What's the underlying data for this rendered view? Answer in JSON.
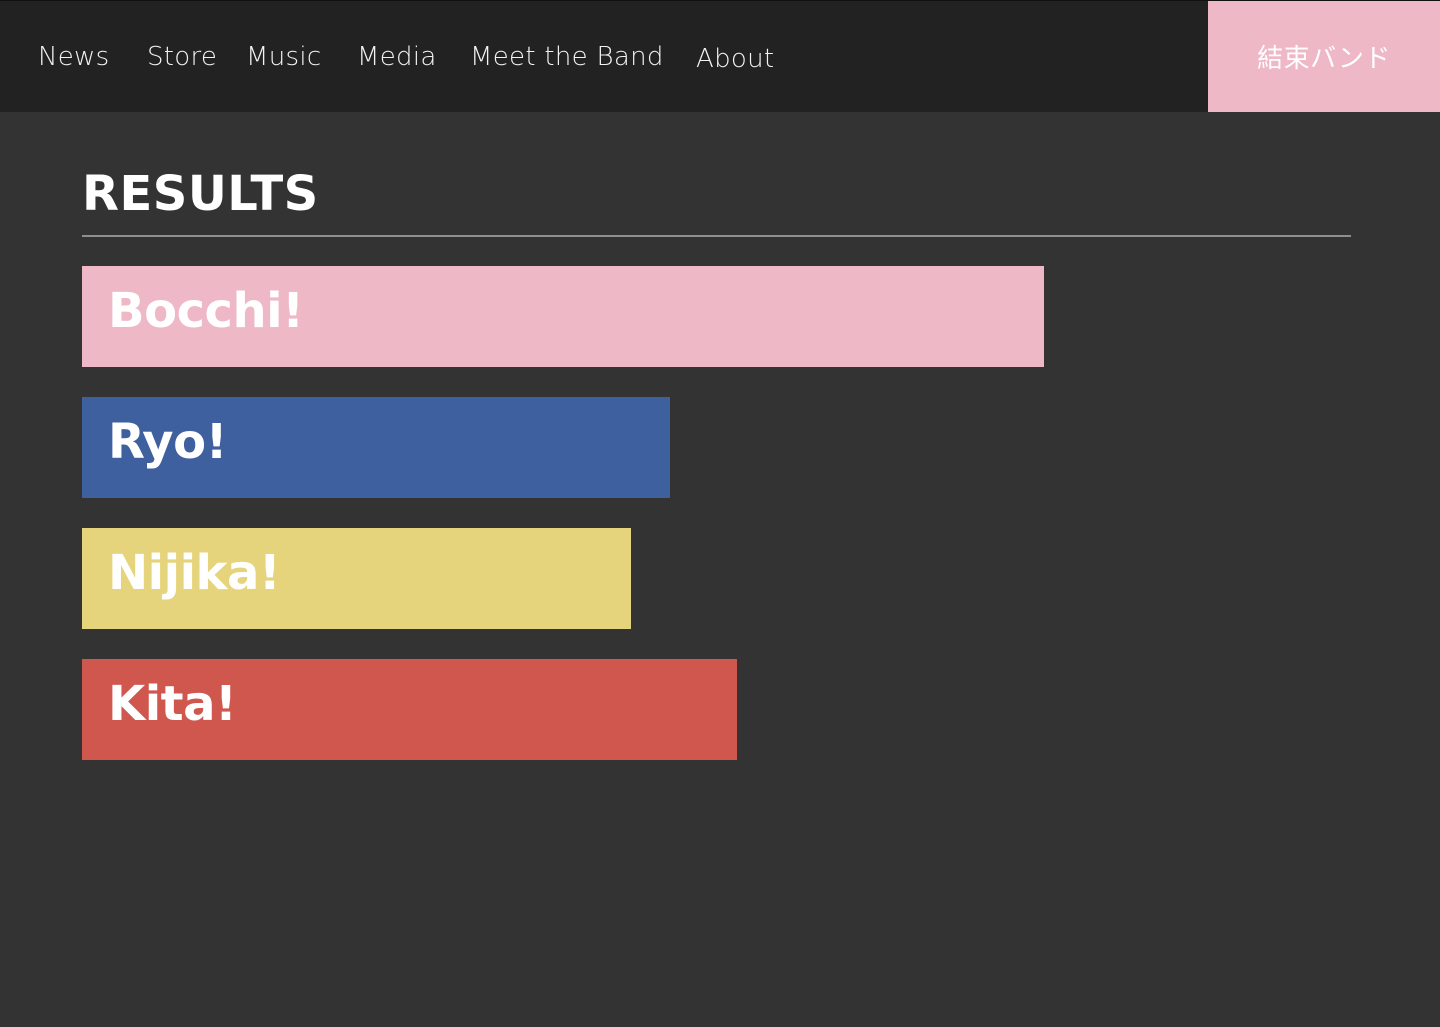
{
  "nav": {
    "items": [
      {
        "label": "News"
      },
      {
        "label": "Store"
      },
      {
        "label": "Music"
      },
      {
        "label": "Media"
      },
      {
        "label": "Meet the Band"
      },
      {
        "label": "About"
      }
    ],
    "brand": {
      "label": "結束バンド"
    }
  },
  "colors": {
    "topbar": "#222222",
    "background": "#333333",
    "brand": "#eeb8c6"
  },
  "results": {
    "title": "RESULTS",
    "items": [
      {
        "label": "Bocchi!",
        "share": 0.758,
        "color": "#eeb8c6"
      },
      {
        "label": "Ryo!",
        "share": 0.463,
        "color": "#3f609e"
      },
      {
        "label": "Nijika!",
        "share": 0.433,
        "color": "#e6d47c"
      },
      {
        "label": "Kita!",
        "share": 0.516,
        "color": "#d0574e"
      }
    ]
  }
}
